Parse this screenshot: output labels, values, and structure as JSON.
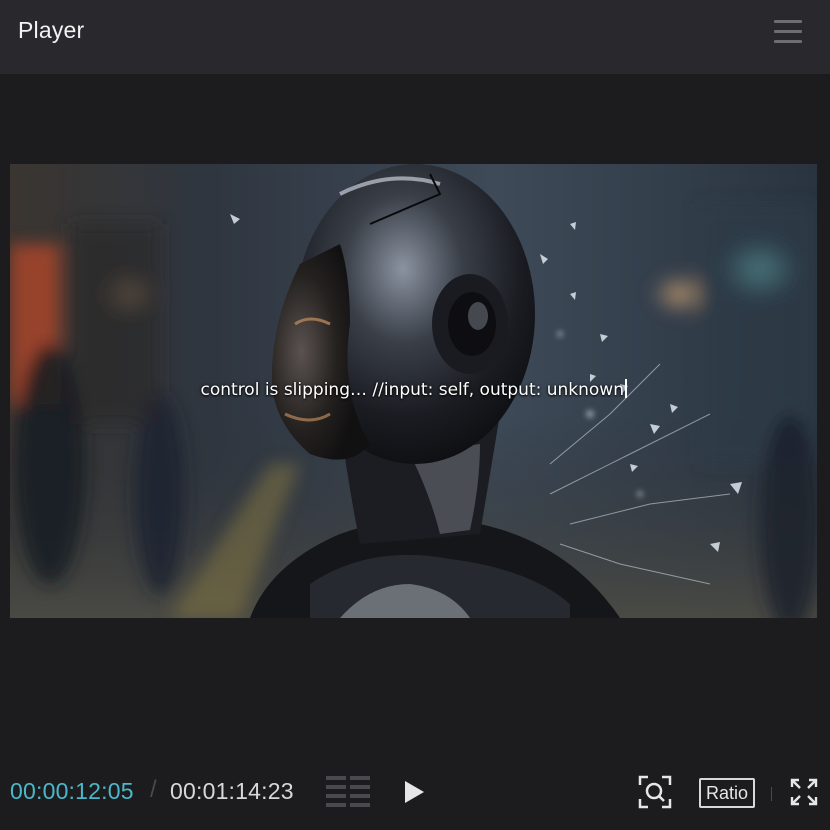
{
  "header": {
    "title": "Player",
    "menu_icon": "hamburger-menu-icon"
  },
  "viewer": {
    "subtitle": "control is slipping… //input: self, output: unknown",
    "image_description_icon": "video-frame"
  },
  "controls": {
    "current_time": "00:00:12:05",
    "separator": "/",
    "total_time": "00:01:14:23",
    "grid_icon": "frame-grid-icon",
    "play_icon": "play-icon",
    "zoom_icon": "zoom-frame-icon",
    "ratio_label": "Ratio",
    "fullscreen_icon": "fullscreen-icon"
  },
  "colors": {
    "header_bg": "#29282d",
    "app_bg": "#1c1c1e",
    "current_time": "#4bb7c9",
    "text": "#d8d8d8"
  }
}
